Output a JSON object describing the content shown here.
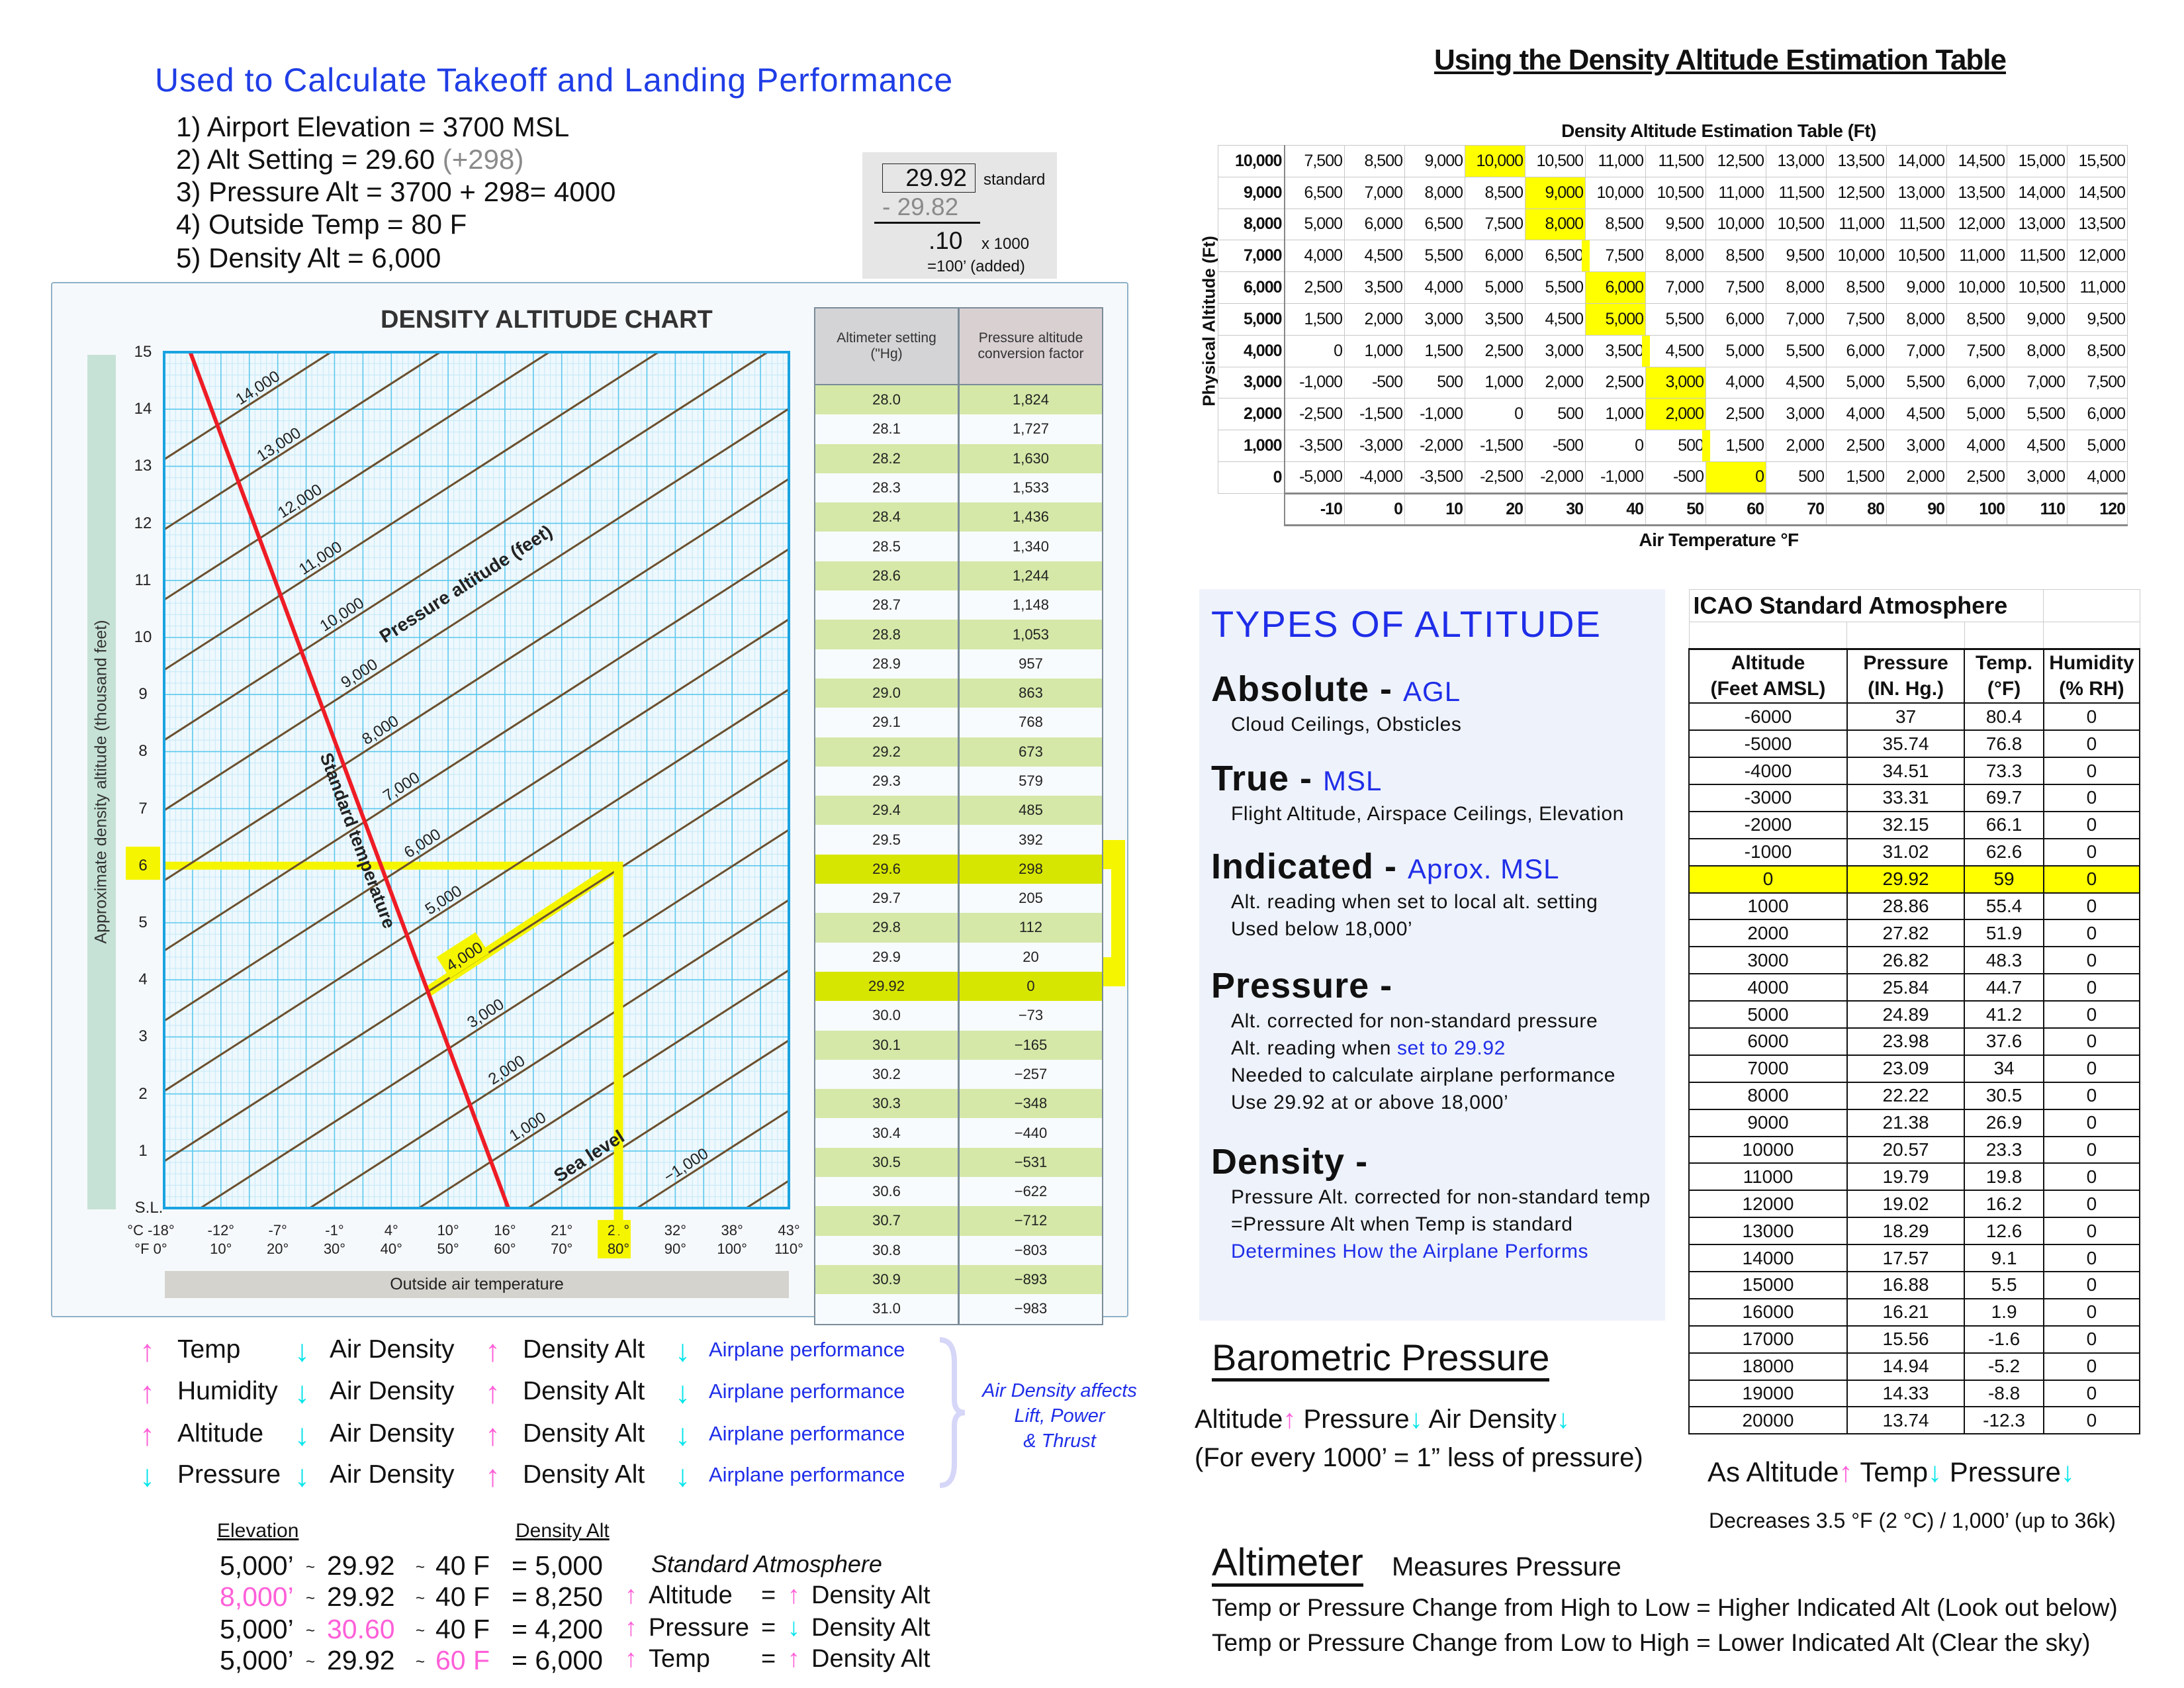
{
  "header": {
    "title": "Used to Calculate Takeoff and Landing Performance",
    "steps": [
      "1) Airport Elevation = 3700 MSL",
      "2) Alt Setting = 29.60 ",
      "3) Pressure Alt = 3700 + 298= 4000",
      "4) Outside Temp = 80 F",
      "5) Density Alt = 6,000"
    ],
    "step2_note": "(+298)"
  },
  "calc": {
    "standard": "29.92",
    "standard_label": "standard",
    "subtract": "- 29.82",
    "result": ".10",
    "multiplier": "x 1000",
    "added": "=100’ (added)"
  },
  "chart_data": {
    "type": "line",
    "title": "DENSITY ALTITUDE CHART",
    "xlabel": "Outside air temperature",
    "ylabel": "Approximate density altitude (thousand feet)",
    "xlim": [
      0,
      110
    ],
    "ylim": [
      0,
      15
    ],
    "x_ticks_f": [
      "°F  0°",
      "10°",
      "20°",
      "30°",
      "40°",
      "50°",
      "60°",
      "70°",
      "80°",
      "90°",
      "100°",
      "110°"
    ],
    "x_ticks_c": [
      "°C -18°",
      "-12°",
      "-7°",
      "-1°",
      "4°",
      "10°",
      "16°",
      "21°",
      "27°",
      "32°",
      "38°",
      "43°"
    ],
    "y_ticks": [
      "S.L.",
      "1",
      "2",
      "3",
      "4",
      "5",
      "6",
      "7",
      "8",
      "9",
      "10",
      "11",
      "12",
      "13",
      "14",
      "15"
    ],
    "grid": true,
    "series_label": "Pressure altitude (feet)",
    "pressure_lines": [
      {
        "label": "",
        "pa": -2000,
        "points": [
          [
            0,
            -6.56
          ],
          [
            110,
            0.48
          ]
        ]
      },
      {
        "label": "−1,000",
        "pa": -1000,
        "points": [
          [
            0,
            -5.33
          ],
          [
            110,
            1.71
          ]
        ]
      },
      {
        "label": "Sea level",
        "pa": 0,
        "points": [
          [
            0,
            -4.1
          ],
          [
            110,
            2.94
          ]
        ]
      },
      {
        "label": "1,000",
        "pa": 1000,
        "points": [
          [
            0,
            -2.87
          ],
          [
            110,
            4.17
          ]
        ]
      },
      {
        "label": "2,000",
        "pa": 2000,
        "points": [
          [
            0,
            -1.64
          ],
          [
            110,
            5.4
          ]
        ]
      },
      {
        "label": "3,000",
        "pa": 3000,
        "points": [
          [
            0,
            -0.41
          ],
          [
            110,
            6.63
          ]
        ]
      },
      {
        "label": "4,000",
        "pa": 4000,
        "points": [
          [
            0,
            0.82
          ],
          [
            110,
            7.86
          ]
        ]
      },
      {
        "label": "5,000",
        "pa": 5000,
        "points": [
          [
            0,
            2.05
          ],
          [
            110,
            9.09
          ]
        ]
      },
      {
        "label": "6,000",
        "pa": 6000,
        "points": [
          [
            0,
            3.28
          ],
          [
            110,
            10.32
          ]
        ]
      },
      {
        "label": "7,000",
        "pa": 7000,
        "points": [
          [
            0,
            4.51
          ],
          [
            110,
            11.55
          ]
        ]
      },
      {
        "label": "8,000",
        "pa": 8000,
        "points": [
          [
            0,
            5.74
          ],
          [
            110,
            12.78
          ]
        ]
      },
      {
        "label": "9,000",
        "pa": 9000,
        "points": [
          [
            0,
            6.97
          ],
          [
            110,
            14.01
          ]
        ]
      },
      {
        "label": "10,000",
        "pa": 10000,
        "points": [
          [
            0,
            8.2
          ],
          [
            110,
            15.24
          ]
        ]
      },
      {
        "label": "11,000",
        "pa": 11000,
        "points": [
          [
            0,
            9.43
          ],
          [
            110,
            16.47
          ]
        ]
      },
      {
        "label": "12,000",
        "pa": 12000,
        "points": [
          [
            0,
            10.66
          ],
          [
            110,
            17.7
          ]
        ]
      },
      {
        "label": "13,000",
        "pa": 13000,
        "points": [
          [
            0,
            11.89
          ],
          [
            110,
            18.93
          ]
        ]
      },
      {
        "label": "14,000",
        "pa": 14000,
        "points": [
          [
            0,
            13.12
          ],
          [
            110,
            20.16
          ]
        ]
      }
    ],
    "standard_temperature": {
      "label": "Standard temperature",
      "points": [
        [
          60.6,
          0
        ],
        [
          4.6,
          15
        ]
      ]
    },
    "example": {
      "pressure_altitude": 4000,
      "temperature_f": 80,
      "density_altitude_k": 6
    },
    "colors": {
      "pressure_line": "#6b4f2e",
      "standard": "#ee1c25",
      "highlight": "#f5f500",
      "grid_major": "#5cc8ee",
      "grid_minor": "#c4e9f7",
      "border": "#1aa3e0"
    }
  },
  "altimeter_table": {
    "headers": [
      "Altimeter setting (\"Hg)",
      "Pressure altitude conversion factor"
    ],
    "highlight_rows": [
      "29.6",
      "29.92"
    ],
    "rows": [
      [
        "28.0",
        "1,824"
      ],
      [
        "28.1",
        "1,727"
      ],
      [
        "28.2",
        "1,630"
      ],
      [
        "28.3",
        "1,533"
      ],
      [
        "28.4",
        "1,436"
      ],
      [
        "28.5",
        "1,340"
      ],
      [
        "28.6",
        "1,244"
      ],
      [
        "28.7",
        "1,148"
      ],
      [
        "28.8",
        "1,053"
      ],
      [
        "28.9",
        "957"
      ],
      [
        "29.0",
        "863"
      ],
      [
        "29.1",
        "768"
      ],
      [
        "29.2",
        "673"
      ],
      [
        "29.3",
        "579"
      ],
      [
        "29.4",
        "485"
      ],
      [
        "29.5",
        "392"
      ],
      [
        "29.6",
        "298"
      ],
      [
        "29.7",
        "205"
      ],
      [
        "29.8",
        "112"
      ],
      [
        "29.9",
        "20"
      ],
      [
        "29.92",
        "0"
      ],
      [
        "30.0",
        "−73"
      ],
      [
        "30.1",
        "−165"
      ],
      [
        "30.2",
        "−257"
      ],
      [
        "30.3",
        "−348"
      ],
      [
        "30.4",
        "−440"
      ],
      [
        "30.5",
        "−531"
      ],
      [
        "30.6",
        "−622"
      ],
      [
        "30.7",
        "−712"
      ],
      [
        "30.8",
        "−803"
      ],
      [
        "30.9",
        "−893"
      ],
      [
        "31.0",
        "−983"
      ]
    ]
  },
  "effects": {
    "rows": [
      [
        [
          "up",
          "Temp"
        ],
        [
          "down",
          "Air Density"
        ],
        [
          "up",
          "Density Alt"
        ],
        [
          "down",
          "Airplane performance"
        ]
      ],
      [
        [
          "up",
          "Humidity"
        ],
        [
          "down",
          "Air Density"
        ],
        [
          "up",
          "Density Alt"
        ],
        [
          "down",
          "Airplane performance"
        ]
      ],
      [
        [
          "up",
          "Altitude"
        ],
        [
          "down",
          "Air Density"
        ],
        [
          "up",
          "Density Alt"
        ],
        [
          "down",
          "Airplane performance"
        ]
      ],
      [
        [
          "down",
          "Pressure"
        ],
        [
          "down",
          "Air Density"
        ],
        [
          "up",
          "Density Alt"
        ],
        [
          "down",
          "Airplane performance"
        ]
      ]
    ],
    "note": [
      "Air Density affects",
      "Lift, Power",
      "& Thrust"
    ]
  },
  "examples": {
    "col_elevation": "Elevation",
    "col_density": "Density Alt",
    "rows": [
      {
        "elev": "5,000’",
        "p": "29.92",
        "t": "40 F",
        "r": "= 5,000",
        "note": "Standard Atmosphere"
      },
      {
        "elev": "8,000’",
        "p": "29.92",
        "t": "40 F",
        "r": "= 8,250",
        "a1": "up",
        "l1": "Altitude",
        "eq": "=",
        "a2": "up",
        "l2": "Density Alt"
      },
      {
        "elev": "5,000’",
        "p": "30.60",
        "t": "40 F",
        "r": "= 4,200",
        "a1": "up",
        "l1": "Pressure",
        "eq": "=",
        "a2": "down",
        "l2": "Density Alt"
      },
      {
        "elev": "5,000’",
        "p": "29.92",
        "t": "60 F",
        "r": "= 6,000",
        "a1": "up",
        "l1": "Temp",
        "eq": "=",
        "a2": "up",
        "l2": "Density Alt"
      }
    ],
    "sep": "~"
  },
  "estimation": {
    "heading": "Using the Density Altitude Estimation Table",
    "title": "Density Altitude Estimation Table (Ft)",
    "ylabel": "Physical Altitude (Ft)",
    "xlabel": "Air Temperature °F",
    "temps": [
      "-10",
      "0",
      "10",
      "20",
      "30",
      "40",
      "50",
      "60",
      "70",
      "80",
      "90",
      "100",
      "110",
      "120"
    ],
    "rows": [
      {
        "alt": "10,000",
        "v": [
          "7,500",
          "8,500",
          "9,000",
          "10,000",
          "10,500",
          "11,000",
          "11,500",
          "12,500",
          "13,000",
          "13,500",
          "14,000",
          "14,500",
          "15,000",
          "15,500"
        ],
        "hl": 3
      },
      {
        "alt": "9,000",
        "v": [
          "6,500",
          "7,000",
          "8,000",
          "8,500",
          "9,000",
          "10,000",
          "10,500",
          "11,000",
          "11,500",
          "12,500",
          "13,000",
          "13,500",
          "14,000",
          "14,500"
        ],
        "hl": 4
      },
      {
        "alt": "8,000",
        "v": [
          "5,000",
          "6,000",
          "6,500",
          "7,500",
          "8,000",
          "8,500",
          "9,500",
          "10,000",
          "10,500",
          "11,000",
          "11,500",
          "12,000",
          "13,000",
          "13,500"
        ],
        "hl": 4
      },
      {
        "alt": "7,000",
        "v": [
          "4,000",
          "4,500",
          "5,500",
          "6,000",
          "6,500",
          "7,500",
          "8,000",
          "8,500",
          "9,500",
          "10,000",
          "10,500",
          "11,000",
          "11,500",
          "12,000"
        ],
        "strip": 5
      },
      {
        "alt": "6,000",
        "v": [
          "2,500",
          "3,500",
          "4,000",
          "5,000",
          "5,500",
          "6,000",
          "7,000",
          "7,500",
          "8,000",
          "8,500",
          "9,000",
          "10,000",
          "10,500",
          "11,000"
        ],
        "hl": 5
      },
      {
        "alt": "5,000",
        "v": [
          "1,500",
          "2,000",
          "3,000",
          "3,500",
          "4,500",
          "5,000",
          "5,500",
          "6,000",
          "7,000",
          "7,500",
          "8,000",
          "8,500",
          "9,000",
          "9,500"
        ],
        "hl": 5
      },
      {
        "alt": "4,000",
        "v": [
          "0",
          "1,000",
          "1,500",
          "2,500",
          "3,000",
          "3,500",
          "4,500",
          "5,000",
          "5,500",
          "6,000",
          "7,000",
          "7,500",
          "8,000",
          "8,500"
        ],
        "strip": 6
      },
      {
        "alt": "3,000",
        "v": [
          "-1,000",
          "-500",
          "500",
          "1,000",
          "2,000",
          "2,500",
          "3,000",
          "4,000",
          "4,500",
          "5,000",
          "5,500",
          "6,000",
          "7,000",
          "7,500"
        ],
        "hl": 6
      },
      {
        "alt": "2,000",
        "v": [
          "-2,500",
          "-1,500",
          "-1,000",
          "0",
          "500",
          "1,000",
          "2,000",
          "2,500",
          "3,000",
          "4,000",
          "4,500",
          "5,000",
          "5,500",
          "6,000"
        ],
        "hl": 6
      },
      {
        "alt": "1,000",
        "v": [
          "-3,500",
          "-3,000",
          "-2,000",
          "-1,500",
          "-500",
          "0",
          "500",
          "1,500",
          "2,000",
          "2,500",
          "3,000",
          "4,000",
          "4,500",
          "5,000"
        ],
        "strip": 7
      },
      {
        "alt": "0",
        "v": [
          "-5,000",
          "-4,000",
          "-3,500",
          "-2,500",
          "-2,000",
          "-1,000",
          "-500",
          "0",
          "500",
          "1,500",
          "2,000",
          "2,500",
          "3,000",
          "4,000"
        ],
        "hl": 7
      }
    ]
  },
  "types": {
    "title": "TYPES OF ALTITUDE",
    "items": [
      {
        "name": "Absolute",
        "dash": " - ",
        "tag": "AGL",
        "lines": [
          "Cloud Ceilings, Obsticles"
        ]
      },
      {
        "name": "True",
        "dash": " - ",
        "tag": "MSL",
        "lines": [
          "Flight Altitude, Airspace Ceilings, Elevation"
        ]
      },
      {
        "name": "Indicated",
        "dash": " - ",
        "tag": "Aprox. MSL",
        "lines": [
          "Alt. reading when set to local alt. setting",
          "Used below 18,000’"
        ]
      },
      {
        "name": "Pressure",
        "dash": " -",
        "tag": "",
        "lines": [
          "Alt. corrected for non-standard pressure",
          "Alt. reading when ",
          "Needed to calculate airplane performance",
          "Use 29.92 at or above 18,000’"
        ]
      },
      {
        "name": "Density",
        "dash": " -",
        "tag": "",
        "lines": [
          "Pressure Alt. corrected for non-standard temp",
          "=Pressure Alt when Temp is standard"
        ]
      }
    ],
    "pressure_highlight": "set to 29.92",
    "density_highlight": "Determines How the Airplane Performs"
  },
  "icao": {
    "title": "ICAO Standard Atmosphere",
    "headers": [
      [
        "Altitude",
        "Pressure",
        "Temp.",
        "Humidity"
      ],
      [
        "(Feet AMSL)",
        "(IN. Hg.)",
        "(°F)",
        "(% RH)"
      ]
    ],
    "highlight_row": "0",
    "rows": [
      [
        "-6000",
        "37",
        "80.4",
        "0"
      ],
      [
        "-5000",
        "35.74",
        "76.8",
        "0"
      ],
      [
        "-4000",
        "34.51",
        "73.3",
        "0"
      ],
      [
        "-3000",
        "33.31",
        "69.7",
        "0"
      ],
      [
        "-2000",
        "32.15",
        "66.1",
        "0"
      ],
      [
        "-1000",
        "31.02",
        "62.6",
        "0"
      ],
      [
        "0",
        "29.92",
        "59",
        "0"
      ],
      [
        "1000",
        "28.86",
        "55.4",
        "0"
      ],
      [
        "2000",
        "27.82",
        "51.9",
        "0"
      ],
      [
        "3000",
        "26.82",
        "48.3",
        "0"
      ],
      [
        "4000",
        "25.84",
        "44.7",
        "0"
      ],
      [
        "5000",
        "24.89",
        "41.2",
        "0"
      ],
      [
        "6000",
        "23.98",
        "37.6",
        "0"
      ],
      [
        "7000",
        "23.09",
        "34",
        "0"
      ],
      [
        "8000",
        "22.22",
        "30.5",
        "0"
      ],
      [
        "9000",
        "21.38",
        "26.9",
        "0"
      ],
      [
        "10000",
        "20.57",
        "23.3",
        "0"
      ],
      [
        "11000",
        "19.79",
        "19.8",
        "0"
      ],
      [
        "12000",
        "19.02",
        "16.2",
        "0"
      ],
      [
        "13000",
        "18.29",
        "12.6",
        "0"
      ],
      [
        "14000",
        "17.57",
        "9.1",
        "0"
      ],
      [
        "15000",
        "16.88",
        "5.5",
        "0"
      ],
      [
        "16000",
        "16.21",
        "1.9",
        "0"
      ],
      [
        "17000",
        "15.56",
        "-1.6",
        "0"
      ],
      [
        "18000",
        "14.94",
        "-5.2",
        "0"
      ],
      [
        "19000",
        "14.33",
        "-8.8",
        "0"
      ],
      [
        "20000",
        "13.74",
        "-12.3",
        "0"
      ]
    ]
  },
  "barometric": {
    "title": "Barometric Pressure",
    "w1": "Altitude",
    "w2": " Pressure",
    "w3": " Air Density",
    "note": "(For every 1000’ = 1” less of pressure)"
  },
  "lapse": {
    "w1": "As Altitude",
    "w2": " Temp",
    "w3": " Pressure",
    "note": "Decreases  3.5 °F (2 °C) / 1,000’ (up to 36k)"
  },
  "altimeter": {
    "title": "Altimeter",
    "subtitle": "Measures Pressure",
    "lines": [
      "Temp or Pressure Change from High to Low = Higher Indicated Alt (Look out below)",
      "Temp or Pressure Change from Low to High = Lower Indicated Alt (Clear the sky)"
    ]
  },
  "arrows": {
    "up": "↑",
    "down": "↓"
  },
  "colors": {
    "title_blue": "#1f3de6",
    "up_arrow": "#ff5fd8",
    "down_arrow": "#00e5ea",
    "highlight": "#ffff00"
  }
}
